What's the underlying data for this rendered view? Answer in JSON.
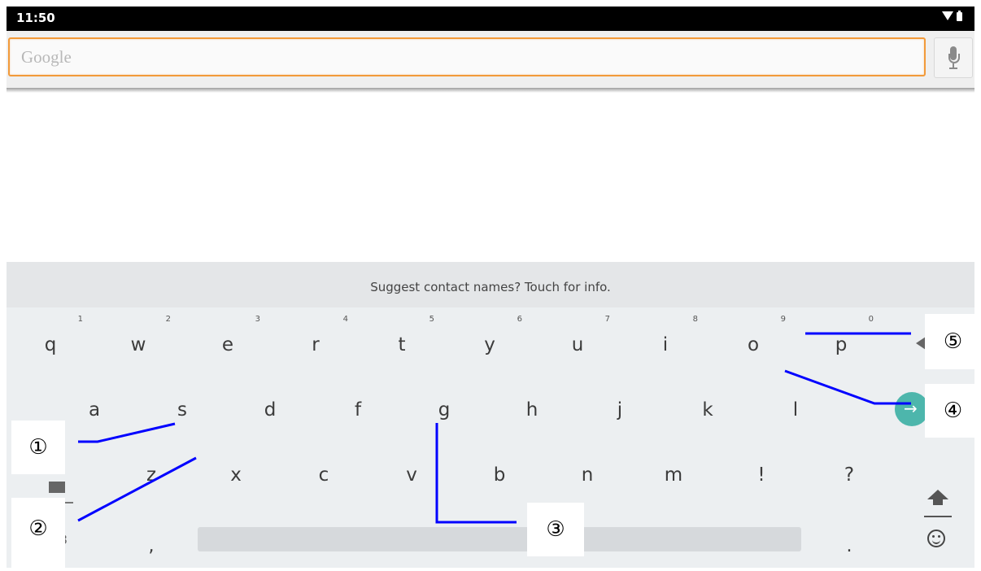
{
  "status_bar": {
    "time": "11:50"
  },
  "search": {
    "placeholder": "Google"
  },
  "keyboard": {
    "suggestion_text": "Suggest contact names? Touch for info.",
    "row1": [
      {
        "key": "q",
        "hint": "1"
      },
      {
        "key": "w",
        "hint": "2"
      },
      {
        "key": "e",
        "hint": "3"
      },
      {
        "key": "r",
        "hint": "4"
      },
      {
        "key": "t",
        "hint": "5"
      },
      {
        "key": "y",
        "hint": "6"
      },
      {
        "key": "u",
        "hint": "7"
      },
      {
        "key": "i",
        "hint": "8"
      },
      {
        "key": "o",
        "hint": "9"
      },
      {
        "key": "p",
        "hint": "0"
      }
    ],
    "row2": [
      "a",
      "s",
      "d",
      "f",
      "g",
      "h",
      "j",
      "k",
      "l"
    ],
    "row3": [
      "z",
      "x",
      "c",
      "v",
      "b",
      "n",
      "m",
      "!",
      "?"
    ],
    "row4": {
      "symbols_partial": "3",
      "comma": ",",
      "period": "."
    },
    "go_arrow": "→"
  },
  "callouts": [
    "①",
    "②",
    "③",
    "④",
    "⑤"
  ],
  "colors": {
    "search_border": "#f29a3a",
    "go_key": "#4db6ac",
    "annotation_line": "#0000ff"
  }
}
